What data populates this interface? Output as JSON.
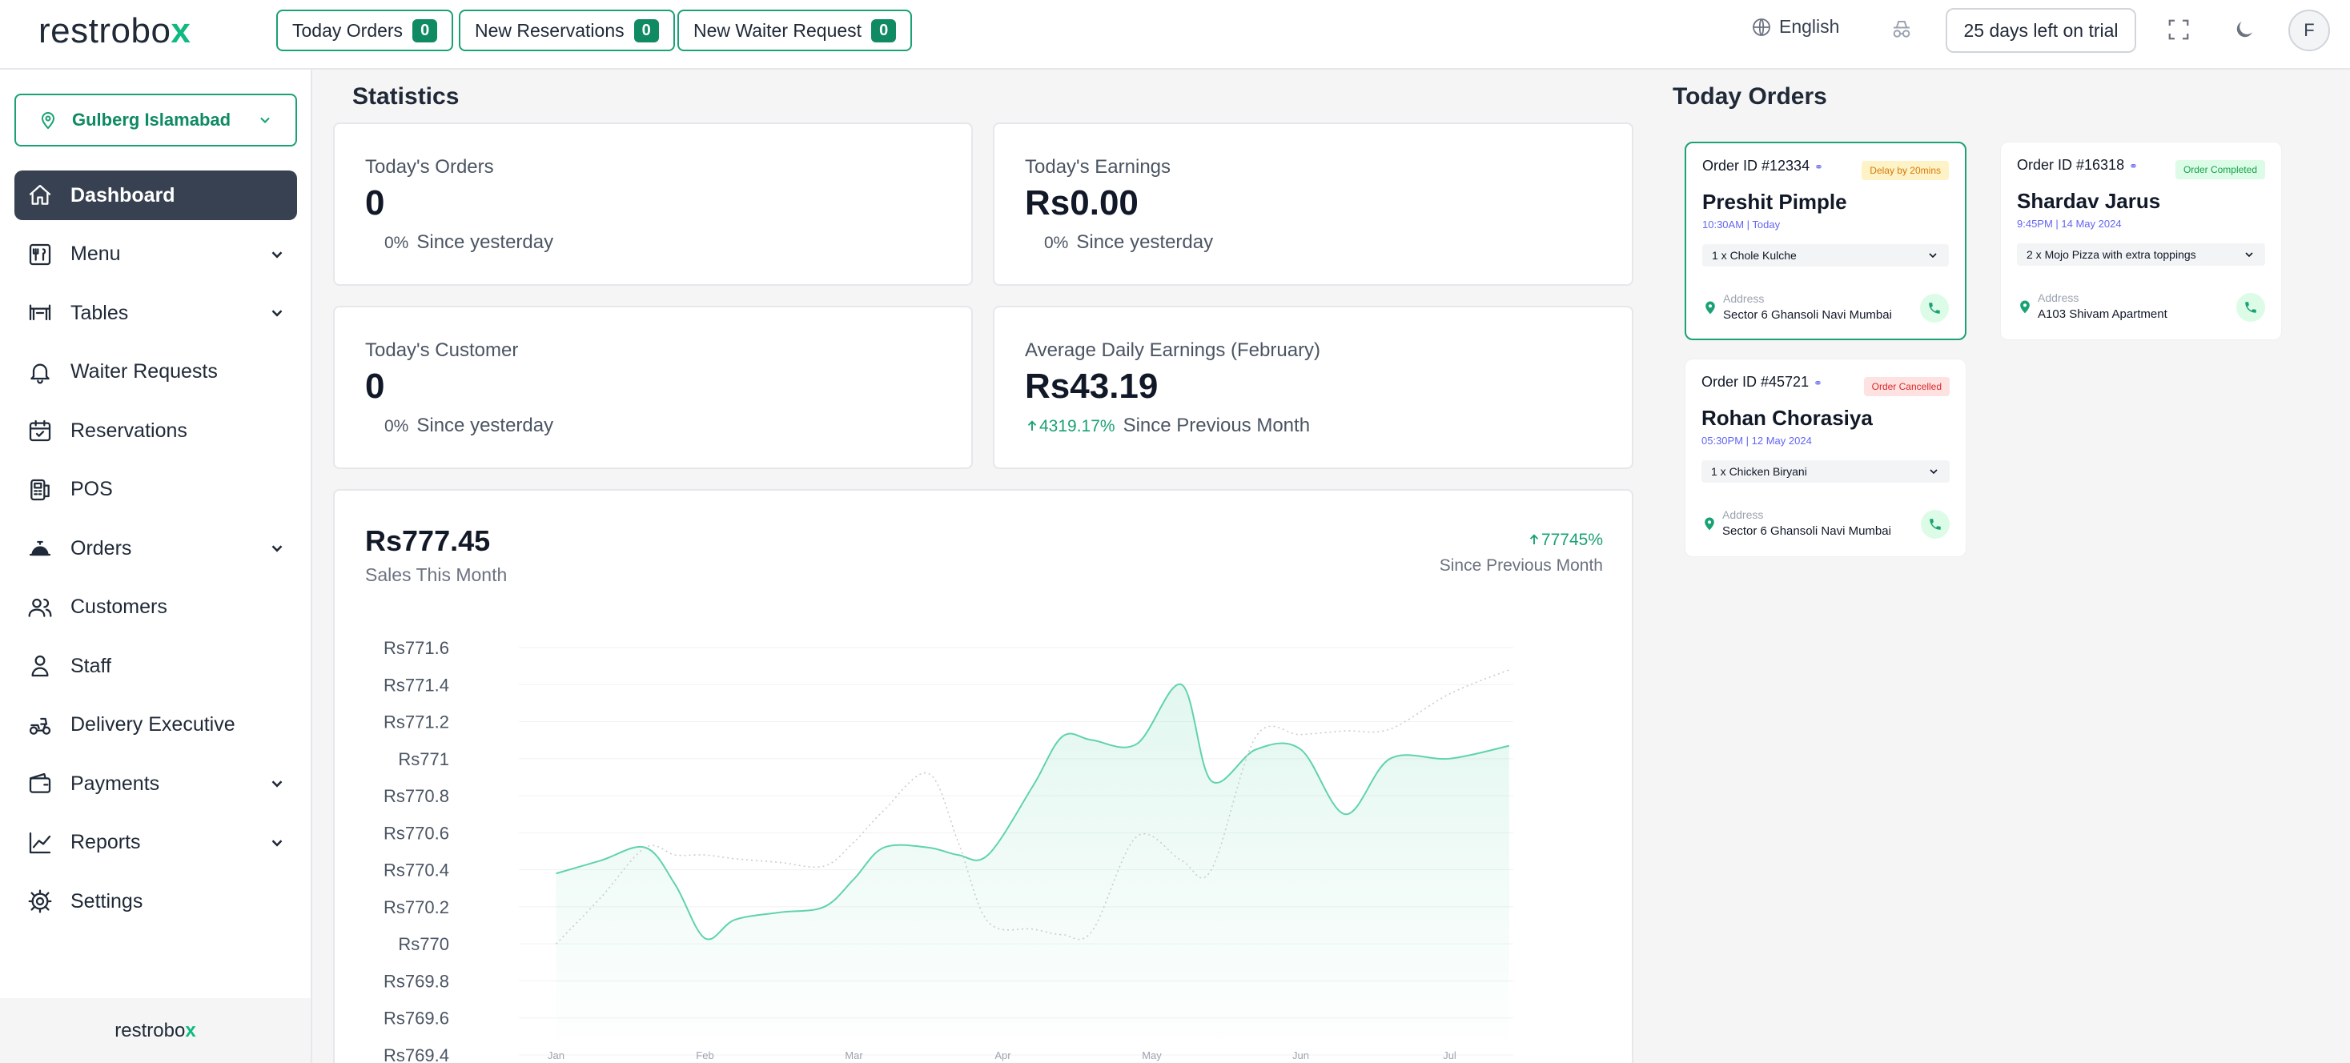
{
  "brand": {
    "name_main": "restrobo",
    "name_accent": "x"
  },
  "topbar": {
    "pills": [
      {
        "label": "Today Orders",
        "count": "0"
      },
      {
        "label": "New Reservations",
        "count": "0"
      },
      {
        "label": "New Waiter Request",
        "count": "0"
      }
    ],
    "language": "English",
    "trial": "25 days left on trial",
    "avatar_initial": "F"
  },
  "sidebar": {
    "branch": "Gulberg Islamabad",
    "items": [
      {
        "label": "Dashboard",
        "icon": "home-icon",
        "active": true,
        "chevron": false
      },
      {
        "label": "Menu",
        "icon": "menu-utensils-icon",
        "active": false,
        "chevron": true
      },
      {
        "label": "Tables",
        "icon": "table-icon",
        "active": false,
        "chevron": true
      },
      {
        "label": "Waiter Requests",
        "icon": "bell-icon",
        "active": false,
        "chevron": false
      },
      {
        "label": "Reservations",
        "icon": "calendar-check-icon",
        "active": false,
        "chevron": false
      },
      {
        "label": "POS",
        "icon": "pos-terminal-icon",
        "active": false,
        "chevron": false
      },
      {
        "label": "Orders",
        "icon": "cloche-icon",
        "active": false,
        "chevron": true
      },
      {
        "label": "Customers",
        "icon": "users-icon",
        "active": false,
        "chevron": false
      },
      {
        "label": "Staff",
        "icon": "person-icon",
        "active": false,
        "chevron": false
      },
      {
        "label": "Delivery Executive",
        "icon": "scooter-icon",
        "active": false,
        "chevron": false
      },
      {
        "label": "Payments",
        "icon": "wallet-icon",
        "active": false,
        "chevron": true
      },
      {
        "label": "Reports",
        "icon": "chart-line-icon",
        "active": false,
        "chevron": true
      },
      {
        "label": "Settings",
        "icon": "gear-icon",
        "active": false,
        "chevron": false
      }
    ],
    "footer_main": "restrobo",
    "footer_accent": "x"
  },
  "statistics": {
    "title": "Statistics",
    "cards": [
      {
        "label": "Today's Orders",
        "value": "0",
        "pct": "0%",
        "since": "Since yesterday",
        "trend": "none"
      },
      {
        "label": "Today's Earnings",
        "value": "Rs0.00",
        "pct": "0%",
        "since": "Since yesterday",
        "trend": "none"
      },
      {
        "label": "Today's Customer",
        "value": "0",
        "pct": "0%",
        "since": "Since yesterday",
        "trend": "none"
      },
      {
        "label": "Average Daily Earnings (February)",
        "value": "Rs43.19",
        "pct": "4319.17%",
        "since": "Since Previous Month",
        "trend": "up"
      }
    ]
  },
  "sales": {
    "value": "Rs777.45",
    "label": "Sales This Month",
    "pct": "77745%",
    "pct_label": "Since Previous Month"
  },
  "chart_data": {
    "type": "line",
    "title": "",
    "xlabel": "",
    "ylabel": "",
    "categories": [
      "Jan",
      "Feb",
      "Mar",
      "Apr",
      "May",
      "Jun",
      "Jul"
    ],
    "x": [
      0,
      0.3,
      0.6,
      0.8,
      1,
      1.2,
      1.5,
      1.8,
      2.0,
      2.2,
      2.5,
      2.7,
      2.9,
      3.2,
      3.4,
      3.6,
      3.9,
      4.2,
      4.4,
      4.7,
      5.0,
      5.3,
      5.6,
      6.0,
      6.4
    ],
    "series": [
      {
        "style": "solid",
        "color": "#5fd3ad",
        "values": [
          770.38,
          770.45,
          770.52,
          770.32,
          770.03,
          770.13,
          770.17,
          770.2,
          770.35,
          770.52,
          770.52,
          770.48,
          770.48,
          770.85,
          771.12,
          771.1,
          771.08,
          771.4,
          770.88,
          771.05,
          771.05,
          770.7,
          771.0,
          771.0,
          771.07
        ]
      },
      {
        "style": "dotted",
        "color": "#c9ccd1",
        "values": [
          770.0,
          770.25,
          770.52,
          770.48,
          770.48,
          770.46,
          770.44,
          770.42,
          770.55,
          770.72,
          770.92,
          770.55,
          770.12,
          770.08,
          770.05,
          770.07,
          770.58,
          770.45,
          770.4,
          771.12,
          771.13,
          771.15,
          771.16,
          771.35,
          771.48
        ]
      }
    ],
    "ylim": [
      769.4,
      771.6
    ],
    "yticks": [
      "Rs771.6",
      "Rs771.4",
      "Rs771.2",
      "Rs771",
      "Rs770.8",
      "Rs770.6",
      "Rs770.4",
      "Rs770.2",
      "Rs770",
      "Rs769.8",
      "Rs769.6",
      "Rs769.4"
    ],
    "grid": true,
    "legend": "none"
  },
  "today_orders": {
    "title": "Today Orders",
    "orders": [
      {
        "id": "Order ID #12334",
        "status": "Delay by 20mins",
        "status_type": "delay",
        "name": "Preshit Pimple",
        "time": "10:30AM | Today",
        "item": "1 x Chole Kulche",
        "address_label": "Address",
        "address": "Sector 6 Ghansoli Navi Mumbai",
        "highlight": true
      },
      {
        "id": "Order ID #16318",
        "status": "Order Completed",
        "status_type": "done",
        "name": "Shardav Jarus",
        "time": "9:45PM | 14 May 2024",
        "item": "2 x Mojo Pizza with extra toppings",
        "address_label": "Address",
        "address": "A103 Shivam Apartment",
        "highlight": false
      },
      {
        "id": "Order ID #45721",
        "status": "Order Cancelled",
        "status_type": "cancel",
        "name": "Rohan Chorasiya",
        "time": "05:30PM | 12 May 2024",
        "item": "1 x Chicken Biryani",
        "address_label": "Address",
        "address": "Sector 6 Ghansoli Navi Mumbai",
        "highlight": false
      }
    ]
  }
}
